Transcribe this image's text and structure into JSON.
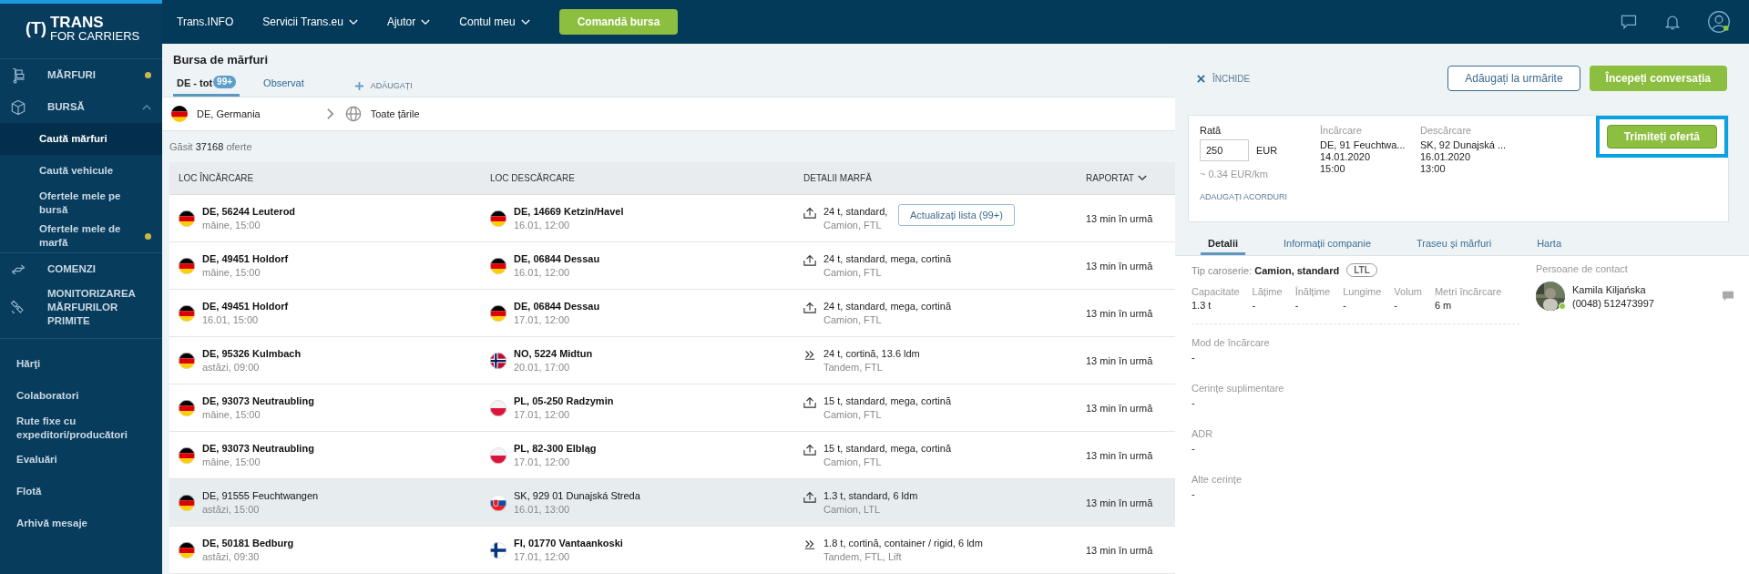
{
  "logo": {
    "mark": "(T)",
    "name": "TRANS",
    "sub": "FOR CARRIERS"
  },
  "top_nav": {
    "items": [
      {
        "label": "Trans.INFO",
        "dropdown": false
      },
      {
        "label": "Servicii Trans.eu",
        "dropdown": true
      },
      {
        "label": "Ajutor",
        "dropdown": true
      },
      {
        "label": "Contul meu",
        "dropdown": true
      }
    ],
    "cta": "Comandă bursa"
  },
  "sidebar": {
    "sections": [
      {
        "label": "MĂRFURI",
        "dot": true
      },
      {
        "label": "BURSĂ",
        "dot": false,
        "expanded": true,
        "children": [
          {
            "label": "Caută mărfuri",
            "selected": true,
            "dot": false
          },
          {
            "label": "Caută vehicule",
            "selected": false,
            "dot": false
          },
          {
            "label": "Ofertele mele pe bursă",
            "selected": false,
            "dot": false
          },
          {
            "label": "Ofertele mele de marfă",
            "selected": false,
            "dot": true
          }
        ]
      },
      {
        "label": "COMENZI",
        "dot": false
      },
      {
        "label": "MONITORIZAREA MĂRFURILOR PRIMITE",
        "dot": false
      }
    ],
    "links": [
      "Hărţi",
      "Colaboratori",
      "Rute fixe cu expeditori/producători",
      "Evaluări",
      "Flotă",
      "Arhivă mesaje"
    ]
  },
  "page": {
    "title": "Bursa de mărfuri",
    "tabs": [
      {
        "label": "DE - tot",
        "badge": "99+",
        "selected": true
      },
      {
        "label": "Observat",
        "selected": false
      }
    ],
    "add_tab": "ADĂUGAȚI",
    "filter": {
      "from": "DE, Germania",
      "to": "Toate țările"
    },
    "found": {
      "prefix": "Găsit",
      "count": "37168",
      "suffix": "oferte"
    },
    "columns": [
      "LOC ÎNCĂRCARE",
      "LOC DESCĂRCARE",
      "DETALII MARFĂ",
      "RAPORTAT"
    ],
    "tooltip": "Actualizați lista (99+)",
    "rows": [
      {
        "load": {
          "kind": "germany",
          "place": "DE, 56244 Leuterod",
          "date": "mâine, 15:00"
        },
        "unload": {
          "kind": "germany",
          "place": "DE, 14669 Ketzin/Havel",
          "date": "16.01, 12:00"
        },
        "cargo": {
          "kind": "top",
          "details": "24 t, standard,",
          "vehicle": "Camion, FTL"
        },
        "reported": "13 min în urmă",
        "selected": false
      },
      {
        "load": {
          "kind": "germany",
          "place": "DE, 49451 Holdorf",
          "date": "mâine, 15:00"
        },
        "unload": {
          "kind": "germany",
          "place": "DE, 06844 Dessau",
          "date": "16.01, 12:00"
        },
        "cargo": {
          "kind": "top",
          "details": "24 t, standard, mega, cortină",
          "vehicle": "Camion, FTL"
        },
        "reported": "13 min în urmă",
        "selected": false
      },
      {
        "load": {
          "kind": "germany",
          "place": "DE, 49451 Holdorf",
          "date": "16.01, 15:00"
        },
        "unload": {
          "kind": "germany",
          "place": "DE, 06844 Dessau",
          "date": "17.01, 12:00"
        },
        "cargo": {
          "kind": "top",
          "details": "24 t, standard, mega, cortină",
          "vehicle": "Camion, FTL"
        },
        "reported": "13 min în urmă",
        "selected": false
      },
      {
        "load": {
          "kind": "germany",
          "place": "DE, 95326 Kulmbach",
          "date": "astăzi, 09:00"
        },
        "unload": {
          "kind": "norway",
          "place": "NO, 5224 Midtun",
          "date": "20.01, 17:00"
        },
        "cargo": {
          "kind": "side",
          "details": "24 t, cortină, 13.6 ldm",
          "vehicle": "Tandem, FTL"
        },
        "reported": "13 min în urmă",
        "selected": false
      },
      {
        "load": {
          "kind": "germany",
          "place": "DE, 93073 Neutraubling",
          "date": "mâine, 15:00"
        },
        "unload": {
          "kind": "poland",
          "place": "PL, 05-250 Radzymin",
          "date": "17.01, 12:00"
        },
        "cargo": {
          "kind": "top",
          "details": "15 t, standard, mega, cortină",
          "vehicle": "Camion, FTL"
        },
        "reported": "13 min în urmă",
        "selected": false
      },
      {
        "load": {
          "kind": "germany",
          "place": "DE, 93073 Neutraubling",
          "date": "mâine, 15:00"
        },
        "unload": {
          "kind": "poland",
          "place": "PL, 82-300 Elbląg",
          "date": "17.01, 12:00"
        },
        "cargo": {
          "kind": "top",
          "details": "15 t, standard, mega, cortină",
          "vehicle": "Camion, FTL"
        },
        "reported": "13 min în urmă",
        "selected": false
      },
      {
        "load": {
          "kind": "germany",
          "place": "DE, 91555 Feuchtwangen",
          "date": "astăzi, 15:00"
        },
        "unload": {
          "kind": "slovakia",
          "place": "SK, 929 01 Dunajská Streda",
          "date": "16.01, 13:00"
        },
        "cargo": {
          "kind": "top",
          "details": "1.3 t, standard, 6 ldm",
          "vehicle": "Camion, LTL"
        },
        "reported": "13 min în urmă",
        "selected": true
      },
      {
        "load": {
          "kind": "germany",
          "place": "DE, 50181 Bedburg",
          "date": "astăzi, 09:30"
        },
        "unload": {
          "kind": "finland",
          "place": "FI, 01770 Vantaankoski",
          "date": "17.01, 12:00"
        },
        "cargo": {
          "kind": "side",
          "details": "1.8 t, cortină, container / rigid, 6 ldm",
          "vehicle": "Tandem, FTL, Lift"
        },
        "reported": "13 min în urmă",
        "selected": false
      }
    ]
  },
  "panel": {
    "close": "ÎNCHIDE",
    "watch_button": "Adăugați la urmărite",
    "chat_button": "Începeți conversația",
    "offer": {
      "rate_label": "Rată",
      "rate": "250",
      "currency": "EUR",
      "per_km": "~ 0.34 EUR/km",
      "agreements": "ADAUGAȚI ACORDURI",
      "loading": {
        "label": "Încărcare",
        "place": "DE, 91 Feuchtwa...",
        "date": "14.01.2020",
        "time": "15:00"
      },
      "unloading": {
        "label": "Descărcare",
        "place": "SK, 92 Dunajská ...",
        "date": "16.01.2020",
        "time": "13:00"
      },
      "send_button": "Trimiteți ofertă"
    },
    "tabs": [
      {
        "label": "Detalii",
        "selected": true
      },
      {
        "label": "Informații companie",
        "selected": false
      },
      {
        "label": "Traseu și mărfuri",
        "selected": false
      },
      {
        "label": "Harta",
        "selected": false
      }
    ],
    "body_type": {
      "label": "Tip caroserie:",
      "value": "Camion, standard",
      "tag": "LTL"
    },
    "specs": [
      {
        "label": "Capacitate",
        "value": "1.3 t"
      },
      {
        "label": "Lățime",
        "value": "-"
      },
      {
        "label": "Înălțime",
        "value": "-"
      },
      {
        "label": "Lungime",
        "value": "-"
      },
      {
        "label": "Volum",
        "value": "-"
      },
      {
        "label": "Metri încărcare",
        "value": "6 m"
      }
    ],
    "fields": [
      {
        "label": "Mod de încărcare",
        "value": "-"
      },
      {
        "label": "Cerințe suplimentare",
        "value": "-"
      },
      {
        "label": "ADR",
        "value": "-"
      },
      {
        "label": "Alte cerințe",
        "value": "-"
      }
    ],
    "contacts": {
      "title": "Persoane de contact",
      "people": [
        {
          "name": "Kamila Kiljańska",
          "phone": "(0048) 512473997",
          "online": true
        }
      ]
    }
  }
}
